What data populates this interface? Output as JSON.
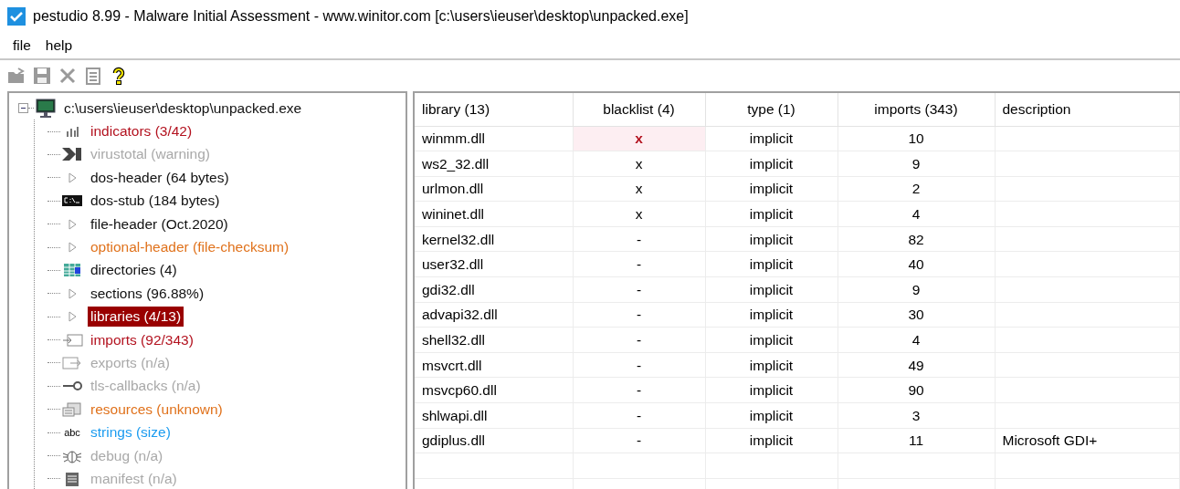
{
  "window": {
    "title": "pestudio 8.99 - Malware Initial Assessment - www.winitor.com [c:\\users\\ieuser\\desktop\\unpacked.exe]"
  },
  "menu": [
    "file",
    "help"
  ],
  "toolbar": [
    {
      "kind": "open",
      "disabled": true
    },
    {
      "kind": "save",
      "disabled": true
    },
    {
      "kind": "close",
      "disabled": true
    },
    {
      "kind": "clipboard",
      "disabled": true
    },
    {
      "kind": "help",
      "disabled": false
    }
  ],
  "tree": {
    "label": "c:\\users\\ieuser\\desktop\\unpacked.exe",
    "expanded": true,
    "children": [
      {
        "label": "indicators (3/42)",
        "color": "#b3121f",
        "kind": "bars",
        "selected": false
      },
      {
        "label": "virustotal (warning)",
        "color": "#a9a9a9",
        "kind": "vt",
        "selected": false
      },
      {
        "label": "dos-header (64 bytes)",
        "color": "#111111",
        "kind": "triangle",
        "selected": false
      },
      {
        "label": "dos-stub (184 bytes)",
        "color": "#111111",
        "kind": "console",
        "selected": false
      },
      {
        "label": "file-header (Oct.2020)",
        "color": "#111111",
        "kind": "triangle",
        "selected": false
      },
      {
        "label": "optional-header (file-checksum)",
        "color": "#e0721c",
        "kind": "triangle",
        "selected": false
      },
      {
        "label": "directories (4)",
        "color": "#111111",
        "kind": "grid",
        "selected": false
      },
      {
        "label": "sections (96.88%)",
        "color": "#111111",
        "kind": "triangle",
        "selected": false
      },
      {
        "label": "libraries (4/13)",
        "kind": "triangle",
        "selected": true
      },
      {
        "label": "imports (92/343)",
        "color": "#b3121f",
        "kind": "import",
        "selected": false
      },
      {
        "label": "exports (n/a)",
        "color": "#a9a9a9",
        "kind": "export",
        "selected": false
      },
      {
        "label": "tls-callbacks (n/a)",
        "color": "#a9a9a9",
        "kind": "key",
        "selected": false
      },
      {
        "label": "resources (unknown)",
        "color": "#e0721c",
        "kind": "resource",
        "selected": false
      },
      {
        "label": "strings (size)",
        "color": "#1c9cf0",
        "kind": "abc",
        "selected": false
      },
      {
        "label": "debug (n/a)",
        "color": "#a9a9a9",
        "kind": "bug",
        "selected": false
      },
      {
        "label": "manifest (n/a)",
        "color": "#a9a9a9",
        "kind": "doc",
        "selected": false
      }
    ]
  },
  "table": {
    "columns": [
      "library (13)",
      "blacklist (4)",
      "type (1)",
      "imports (343)",
      "description"
    ],
    "rows": [
      {
        "cells": [
          "winmm.dll",
          "x",
          "implicit",
          "10",
          ""
        ],
        "flagged": true
      },
      {
        "cells": [
          "ws2_32.dll",
          "x",
          "implicit",
          "9",
          ""
        ],
        "flagged": false
      },
      {
        "cells": [
          "urlmon.dll",
          "x",
          "implicit",
          "2",
          ""
        ],
        "flagged": false
      },
      {
        "cells": [
          "wininet.dll",
          "x",
          "implicit",
          "4",
          ""
        ],
        "flagged": false
      },
      {
        "cells": [
          "kernel32.dll",
          "-",
          "implicit",
          "82",
          ""
        ],
        "flagged": false
      },
      {
        "cells": [
          "user32.dll",
          "-",
          "implicit",
          "40",
          ""
        ],
        "flagged": false
      },
      {
        "cells": [
          "gdi32.dll",
          "-",
          "implicit",
          "9",
          ""
        ],
        "flagged": false
      },
      {
        "cells": [
          "advapi32.dll",
          "-",
          "implicit",
          "30",
          ""
        ],
        "flagged": false
      },
      {
        "cells": [
          "shell32.dll",
          "-",
          "implicit",
          "4",
          ""
        ],
        "flagged": false
      },
      {
        "cells": [
          "msvcrt.dll",
          "-",
          "implicit",
          "49",
          ""
        ],
        "flagged": false
      },
      {
        "cells": [
          "msvcp60.dll",
          "-",
          "implicit",
          "90",
          ""
        ],
        "flagged": false
      },
      {
        "cells": [
          "shlwapi.dll",
          "-",
          "implicit",
          "3",
          ""
        ],
        "flagged": false
      },
      {
        "cells": [
          "gdiplus.dll",
          "-",
          "implicit",
          "11",
          "Microsoft GDI+"
        ],
        "flagged": false
      }
    ]
  }
}
